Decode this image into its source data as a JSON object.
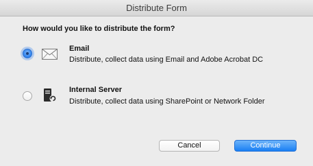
{
  "window": {
    "title": "Distribute Form"
  },
  "dialog": {
    "question": "How would you like to distribute the form?",
    "options": [
      {
        "title": "Email",
        "description": "Distribute, collect data using Email and Adobe Acrobat DC",
        "selected": true,
        "icon": "envelope-icon"
      },
      {
        "title": "Internal Server",
        "description": "Distribute, collect data using SharePoint or Network Folder",
        "selected": false,
        "icon": "server-icon"
      }
    ]
  },
  "buttons": {
    "cancel_label": "Cancel",
    "continue_label": "Continue"
  }
}
